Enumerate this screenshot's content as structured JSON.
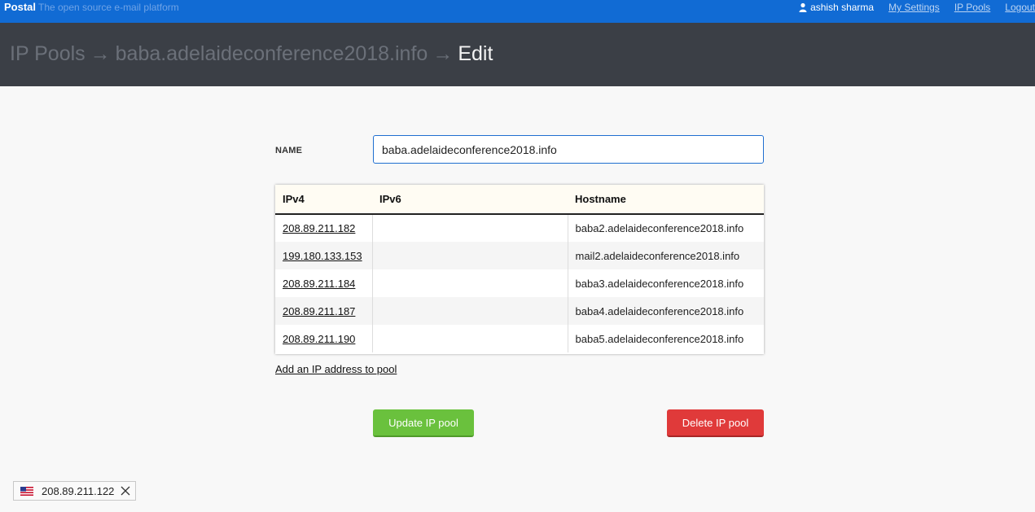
{
  "topbar": {
    "brand": "Postal",
    "tagline": "The open source e-mail platform",
    "user_name": "ashish sharma",
    "links": [
      "My Settings",
      "IP Pools",
      "Logout"
    ]
  },
  "breadcrumb": {
    "section": "IP Pools",
    "pool": "baba.adelaideconference2018.info",
    "current": "Edit",
    "separator": "→"
  },
  "form": {
    "name_label": "NAME",
    "name_value": "baba.adelaideconference2018.info"
  },
  "ip_table": {
    "headers": [
      "IPv4",
      "IPv6",
      "Hostname"
    ],
    "rows": [
      {
        "ipv4": "208.89.211.182",
        "ipv6": "",
        "hostname": "baba2.adelaideconference2018.info"
      },
      {
        "ipv4": "199.180.133.153",
        "ipv6": "",
        "hostname": "mail2.adelaideconference2018.info"
      },
      {
        "ipv4": "208.89.211.184",
        "ipv6": "",
        "hostname": "baba3.adelaideconference2018.info"
      },
      {
        "ipv4": "208.89.211.187",
        "ipv6": "",
        "hostname": "baba4.adelaideconference2018.info"
      },
      {
        "ipv4": "208.89.211.190",
        "ipv6": "",
        "hostname": "baba5.adelaideconference2018.info"
      }
    ]
  },
  "add_link": "Add an IP address to pool",
  "buttons": {
    "update": "Update IP pool",
    "delete": "Delete IP pool"
  },
  "ip_widget": {
    "ip": "208.89.211.122",
    "flag_icon": "us-flag-icon",
    "close_icon": "close-icon"
  },
  "colors": {
    "topbar": "#116bd4",
    "header": "#3b3f46",
    "update_button": "#6ac13d",
    "delete_button": "#e03a3a"
  }
}
